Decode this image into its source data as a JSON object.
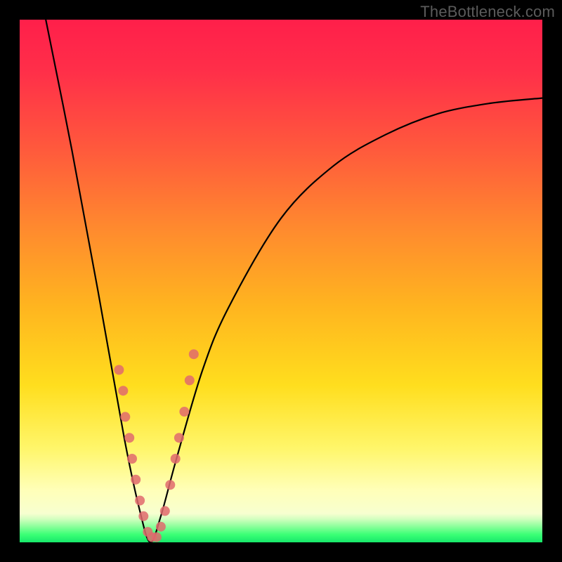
{
  "watermark": "TheBottleneck.com",
  "chart_data": {
    "type": "line",
    "title": "",
    "xlabel": "",
    "ylabel": "",
    "xlim": [
      0,
      100
    ],
    "ylim": [
      0,
      100
    ],
    "grid": false,
    "legend": false,
    "annotations": [],
    "curve_note": "Asymmetric V-shaped bottleneck curve; minimum near x≈25; left branch steep to top-left, right branch shallower rising to upper-right.",
    "series": [
      {
        "name": "bottleneck-curve",
        "x": [
          5,
          10,
          15,
          20,
          23,
          25,
          27,
          30,
          35,
          40,
          50,
          60,
          70,
          80,
          90,
          100
        ],
        "y": [
          100,
          75,
          48,
          20,
          6,
          0,
          5,
          16,
          33,
          45,
          62,
          72,
          78,
          82,
          84,
          85
        ]
      }
    ],
    "scatter_points": {
      "name": "sample-dots",
      "color": "#e06a6d",
      "points": [
        {
          "x": 19.0,
          "y": 33
        },
        {
          "x": 19.8,
          "y": 29
        },
        {
          "x": 20.2,
          "y": 24
        },
        {
          "x": 21.0,
          "y": 20
        },
        {
          "x": 21.5,
          "y": 16
        },
        {
          "x": 22.2,
          "y": 12
        },
        {
          "x": 23.0,
          "y": 8
        },
        {
          "x": 23.7,
          "y": 5
        },
        {
          "x": 24.5,
          "y": 2
        },
        {
          "x": 25.3,
          "y": 1
        },
        {
          "x": 26.2,
          "y": 1
        },
        {
          "x": 27.0,
          "y": 3
        },
        {
          "x": 27.8,
          "y": 6
        },
        {
          "x": 28.8,
          "y": 11
        },
        {
          "x": 29.8,
          "y": 16
        },
        {
          "x": 30.5,
          "y": 20
        },
        {
          "x": 31.5,
          "y": 25
        },
        {
          "x": 32.5,
          "y": 31
        },
        {
          "x": 33.3,
          "y": 36
        }
      ]
    },
    "background_gradient": {
      "description": "Vertical gradient: red at top through orange and yellow to pale yellow, ending in a thin bright green band at the bottom."
    }
  }
}
